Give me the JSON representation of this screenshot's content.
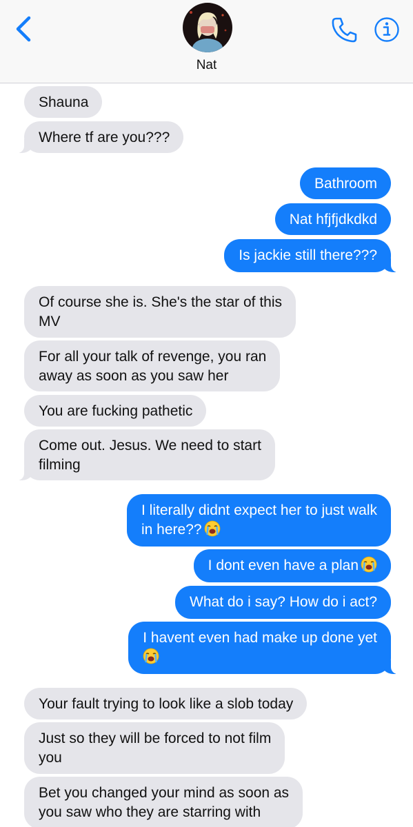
{
  "header": {
    "contact_name": "Nat",
    "back_icon": "chevron-left-icon",
    "call_icon": "phone-icon",
    "info_icon": "info-icon",
    "accent_color": "#147efb"
  },
  "messages": [
    {
      "dir": "in",
      "text": "Shauna"
    },
    {
      "dir": "in",
      "text": "Where tf are you???"
    },
    {
      "dir": "out",
      "text": "Bathroom"
    },
    {
      "dir": "out",
      "text": "Nat hfjfjdkdkd"
    },
    {
      "dir": "out",
      "text": "Is jackie still there???"
    },
    {
      "dir": "in",
      "line1": "Of course she is. She's the star of this",
      "line2": "MV"
    },
    {
      "dir": "in",
      "line1": "For all your talk of revenge, you ran",
      "line2": "away as soon as you saw her"
    },
    {
      "dir": "in",
      "text": "You are fucking pathetic"
    },
    {
      "dir": "in",
      "line1": "Come out. Jesus. We need to start",
      "line2": "filming"
    },
    {
      "dir": "out",
      "line1": "I literally didnt expect her to just walk",
      "line2": "in here??",
      "emoji": "loudly-crying-face-emoji"
    },
    {
      "dir": "out",
      "text": "I dont even have a plan",
      "emoji": "loudly-crying-face-emoji"
    },
    {
      "dir": "out",
      "text": "What do i say? How do i act?"
    },
    {
      "dir": "out",
      "line1": "I havent even had make up done yet",
      "line2": "",
      "emoji": "loudly-crying-face-emoji"
    },
    {
      "dir": "in",
      "text": "Your fault trying to look like a slob today"
    },
    {
      "dir": "in",
      "line1": "Just so they will be forced to not film",
      "line2": "you"
    },
    {
      "dir": "in",
      "line1": "Bet you changed your mind as soon as",
      "line2": "you saw who they are starring with"
    }
  ]
}
